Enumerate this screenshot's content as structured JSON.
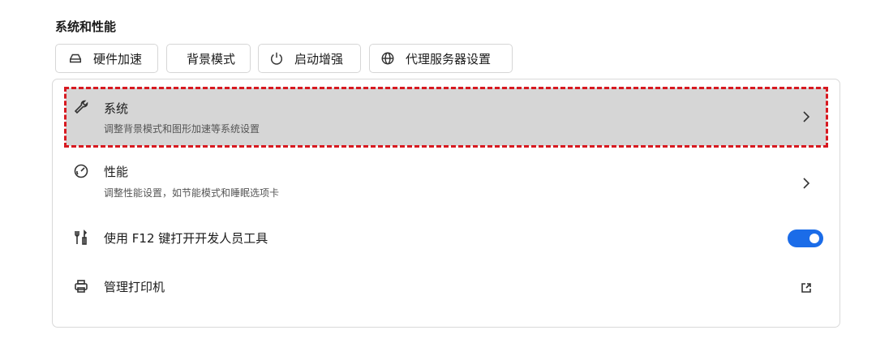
{
  "section": {
    "title": "系统和性能"
  },
  "chips": [
    {
      "label": "硬件加速",
      "icon": "hardware-accel-icon"
    },
    {
      "label": "背景模式",
      "icon": ""
    },
    {
      "label": "启动增强",
      "icon": "power-icon"
    },
    {
      "label": "代理服务器设置",
      "icon": "globe-icon"
    }
  ],
  "rows": {
    "system": {
      "title": "系统",
      "subtitle": "调整背景模式和图形加速等系统设置",
      "icon": "wrench-icon"
    },
    "performance": {
      "title": "性能",
      "subtitle": "调整性能设置，如节能模式和睡眠选项卡",
      "icon": "performance-icon"
    },
    "devtools": {
      "title": "使用 F12 键打开开发人员工具",
      "icon": "tools-icon",
      "toggle_on": true
    },
    "printers": {
      "title": "管理打印机",
      "icon": "printer-icon"
    }
  },
  "colors": {
    "accent": "#1b6ce8",
    "highlight_border": "#d71920",
    "highlight_bg": "#d6d6d6"
  }
}
